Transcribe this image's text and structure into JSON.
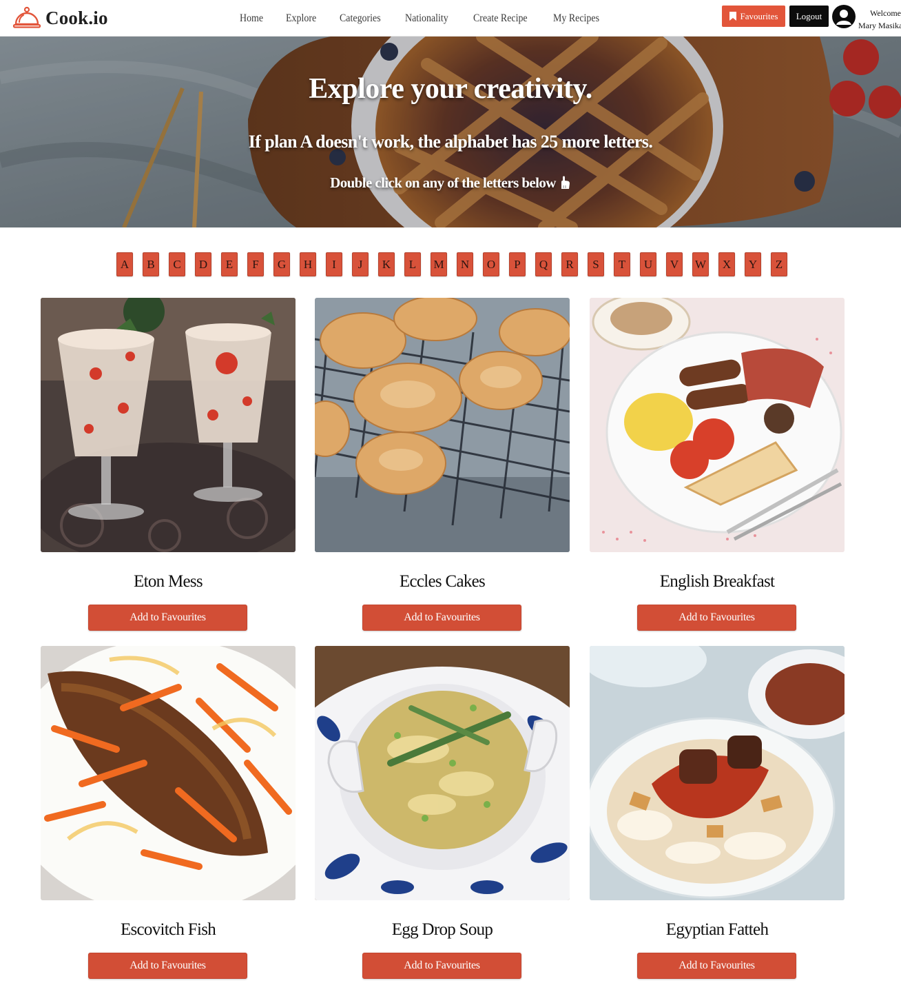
{
  "header": {
    "logo_text": "Cook.io",
    "nav": [
      "Home",
      "Explore",
      "Categories",
      "Nationality",
      "Create Recipe",
      "My Recipes"
    ],
    "favourites_label": "Favourites",
    "logout_label": "Logout",
    "welcome_label": "Welcome",
    "user_name": "Mary Masika"
  },
  "hero": {
    "title": "Explore your creativity.",
    "subtitle": "If plan A doesn't work, the alphabet has 25 more letters.",
    "hint": "Double click on any of the letters below"
  },
  "alphabet": [
    "A",
    "B",
    "C",
    "D",
    "E",
    "F",
    "G",
    "H",
    "I",
    "J",
    "K",
    "L",
    "M",
    "N",
    "O",
    "P",
    "Q",
    "R",
    "S",
    "T",
    "U",
    "V",
    "W",
    "X",
    "Y",
    "Z"
  ],
  "recipes": [
    {
      "name": "Eton Mess",
      "button": "Add to Favourites"
    },
    {
      "name": "Eccles Cakes",
      "button": "Add to Favourites"
    },
    {
      "name": "English Breakfast",
      "button": "Add to Favourites"
    },
    {
      "name": "Escovitch Fish",
      "button": "Add to Favourites"
    },
    {
      "name": "Egg Drop Soup",
      "button": "Add to Favourites"
    },
    {
      "name": "Egyptian Fatteh",
      "button": "Add to Favourites"
    }
  ],
  "colors": {
    "accent": "#d24e36",
    "favourites_button": "#e2553a",
    "logout_button": "#0c0c0c"
  },
  "icons": {
    "logo": "cloche-icon",
    "favourites": "bookmark-icon",
    "avatar": "user-avatar-icon",
    "hint": "pointing-hand-icon"
  }
}
